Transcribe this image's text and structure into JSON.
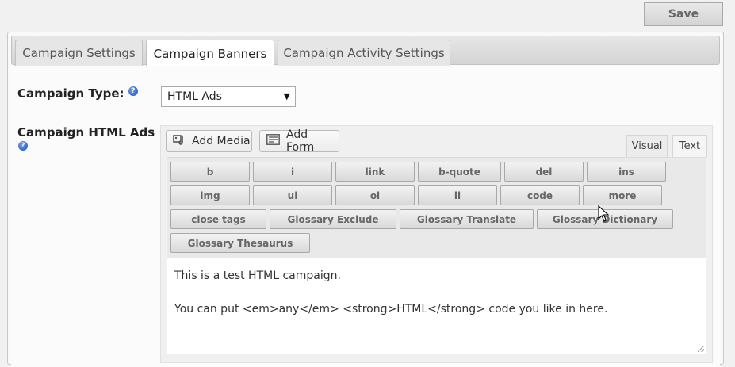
{
  "toolbar": {
    "save_label": "Save"
  },
  "tabs": [
    {
      "label": "Campaign Settings",
      "active": false
    },
    {
      "label": "Campaign Banners",
      "active": true
    },
    {
      "label": "Campaign Activity Settings",
      "active": false
    }
  ],
  "form": {
    "campaign_type_label": "Campaign Type:",
    "campaign_type_value": "HTML Ads",
    "campaign_html_label": "Campaign HTML Ads",
    "help_icon": "help-icon"
  },
  "editor": {
    "add_media_label": "Add Media",
    "add_form_label": "Add Form",
    "visual_tab": "Visual",
    "text_tab": "Text",
    "active_mode": "Text",
    "quicktags": [
      "b",
      "i",
      "link",
      "b-quote",
      "del",
      "ins",
      "img",
      "ul",
      "ol",
      "li",
      "code",
      "more",
      "close tags",
      "Glossary Exclude",
      "Glossary Translate",
      "Glossary Dictionary",
      "Glossary Thesaurus"
    ],
    "content_line1": "This is a test HTML campaign.",
    "content_line2": "You can put <em>any</em> <strong>HTML</strong> code you like in here."
  }
}
